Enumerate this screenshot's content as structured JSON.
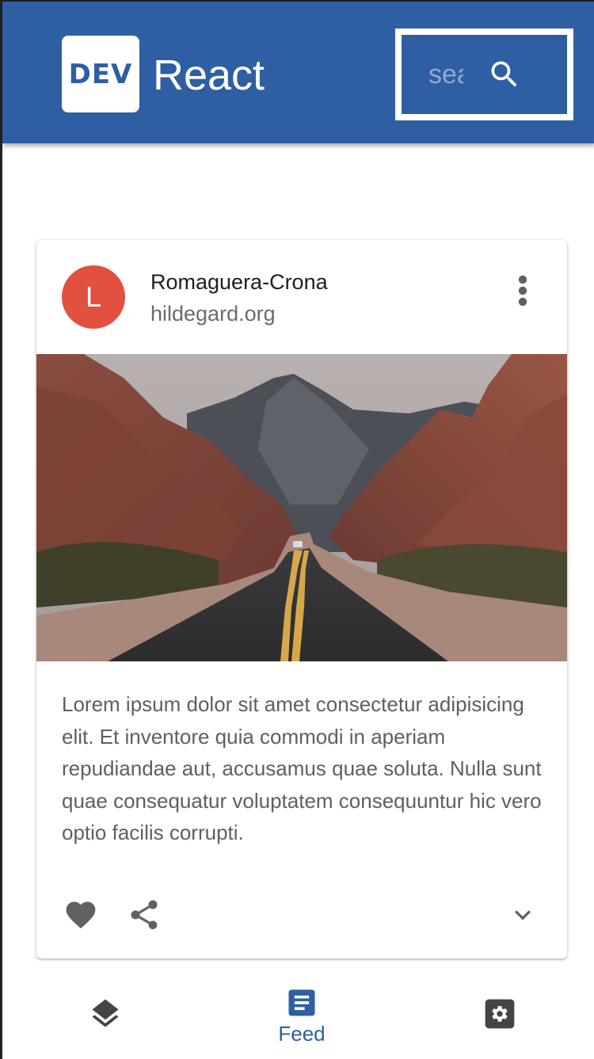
{
  "header": {
    "logo_text": "DEV",
    "title": "React",
    "search": {
      "placeholder": "search"
    },
    "colors": {
      "primary": "#2e5fa3"
    }
  },
  "card": {
    "avatar_letter": "L",
    "avatar_color": "#e2503f",
    "title": "Romaguera-Crona",
    "subtitle": "hildegard.org",
    "image": "desert-road-between-red-rock-canyon",
    "body": "Lorem ipsum dolor sit amet consectetur adipisicing elit. Et inventore quia commodi in aperiam repudiandae aut, accusamus quae soluta. Nulla sunt quae consequatur voluptatem consequuntur hic vero optio facilis corrupti.",
    "actions": [
      "favorite-icon",
      "share-icon",
      "expand-more-icon"
    ],
    "menu_icon": "more-vert-icon"
  },
  "bottom_nav": {
    "items": [
      {
        "icon": "layers-icon",
        "label": ""
      },
      {
        "icon": "article-icon",
        "label": "Feed",
        "selected": true
      },
      {
        "icon": "settings-icon",
        "label": ""
      }
    ]
  }
}
